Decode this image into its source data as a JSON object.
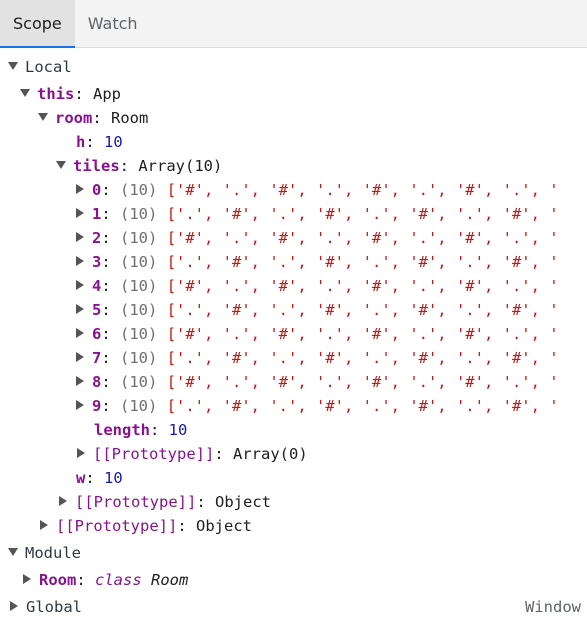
{
  "tabs": [
    {
      "label": "Scope",
      "active": true
    },
    {
      "label": "Watch",
      "active": false
    }
  ],
  "scope": {
    "local_label": "Local",
    "this_name": "this",
    "this_type": "App",
    "room_name": "room",
    "room_type": "Room",
    "h_name": "h",
    "h_value": "10",
    "tiles_name": "tiles",
    "tiles_type": "Array(10)",
    "tile_rows": [
      {
        "index": "0",
        "count": "(10)",
        "preview": "['#', '.', '#', '.', '#', '.', '#', '.', '"
      },
      {
        "index": "1",
        "count": "(10)",
        "preview": "['.', '#', '.', '#', '.', '#', '.', '#', '"
      },
      {
        "index": "2",
        "count": "(10)",
        "preview": "['#', '.', '#', '.', '#', '.', '#', '.', '"
      },
      {
        "index": "3",
        "count": "(10)",
        "preview": "['.', '#', '.', '#', '.', '#', '.', '#', '"
      },
      {
        "index": "4",
        "count": "(10)",
        "preview": "['#', '.', '#', '.', '#', '.', '#', '.', '"
      },
      {
        "index": "5",
        "count": "(10)",
        "preview": "['.', '#', '.', '#', '.', '#', '.', '#', '"
      },
      {
        "index": "6",
        "count": "(10)",
        "preview": "['#', '.', '#', '.', '#', '.', '#', '.', '"
      },
      {
        "index": "7",
        "count": "(10)",
        "preview": "['.', '#', '.', '#', '.', '#', '.', '#', '"
      },
      {
        "index": "8",
        "count": "(10)",
        "preview": "['#', '.', '#', '.', '#', '.', '#', '.', '"
      },
      {
        "index": "9",
        "count": "(10)",
        "preview": "['.', '#', '.', '#', '.', '#', '.', '#', '"
      }
    ],
    "length_name": "length",
    "length_value": "10",
    "tiles_proto_name": "[[Prototype]]",
    "tiles_proto_value": "Array(0)",
    "w_name": "w",
    "w_value": "10",
    "room_proto_name": "[[Prototype]]",
    "room_proto_value": "Object",
    "this_proto_name": "[[Prototype]]",
    "this_proto_value": "Object",
    "module_label": "Module",
    "module_room_name": "Room",
    "module_room_keyword": "class",
    "module_room_value": "Room",
    "global_label": "Global",
    "global_value": "Window"
  },
  "colors": {
    "accent": "#1a73e8",
    "property": "#881391",
    "number": "#1a1aa6",
    "string": "#c41a16"
  }
}
